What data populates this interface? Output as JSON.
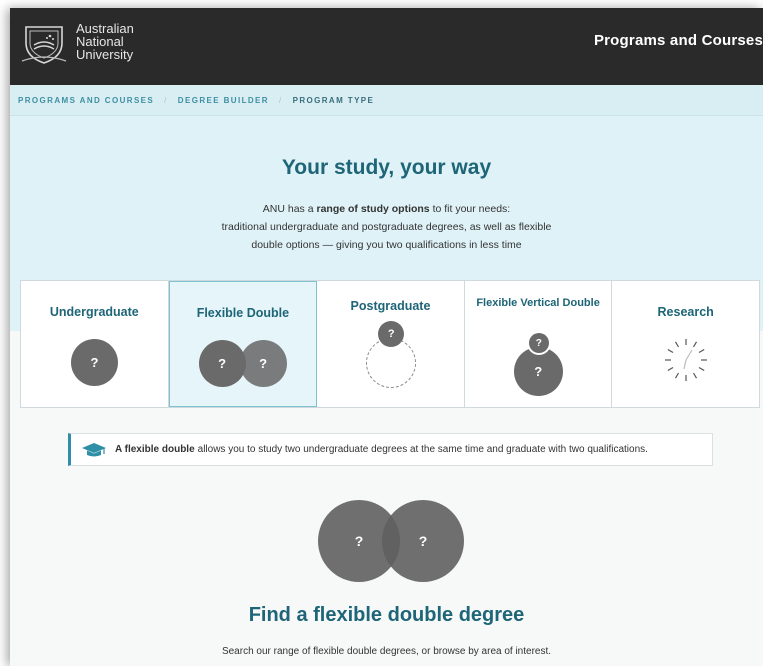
{
  "header": {
    "logo_lines": [
      "Australian",
      "National",
      "University"
    ],
    "site_title": "Programs and Courses"
  },
  "breadcrumb": {
    "items": [
      "PROGRAMS AND COURSES",
      "DEGREE BUILDER",
      "PROGRAM TYPE"
    ],
    "separator": "/"
  },
  "hero": {
    "title": "Your study, your way",
    "intro_prefix": "ANU has a ",
    "intro_bold": "range of study options",
    "intro_suffix": " to fit your needs:",
    "intro_line2": "traditional undergraduate and postgraduate degrees, as well as flexible",
    "intro_line3": "double options — giving you two qualifications in less time"
  },
  "cards": [
    {
      "label": "Undergraduate",
      "selected": false,
      "icon": "single-circle"
    },
    {
      "label": "Flexible Double",
      "selected": true,
      "icon": "double-circle"
    },
    {
      "label": "Postgraduate",
      "selected": false,
      "icon": "small-circle-with-dashed-ring"
    },
    {
      "label": "Flexible Vertical Double",
      "selected": false,
      "icon": "stacked-circles"
    },
    {
      "label": "Research",
      "selected": false,
      "icon": "radiating-ticks"
    }
  ],
  "info": {
    "icon": "graduation-cap-icon",
    "bold": "A flexible double",
    "text": "allows you to study two undergraduate degrees at the same time and graduate with two qualifications."
  },
  "venn": {
    "left": "?",
    "right": "?"
  },
  "placeholder_mark": "?",
  "find": {
    "title": "Find a flexible double degree",
    "subtitle": "Search our range of flexible double degrees, or browse by area of interest."
  },
  "colors": {
    "header_bg": "#2a2a2a",
    "accent": "#1d6577",
    "hero_bg": "#dff2f7",
    "circle": "#6a6a6a"
  }
}
